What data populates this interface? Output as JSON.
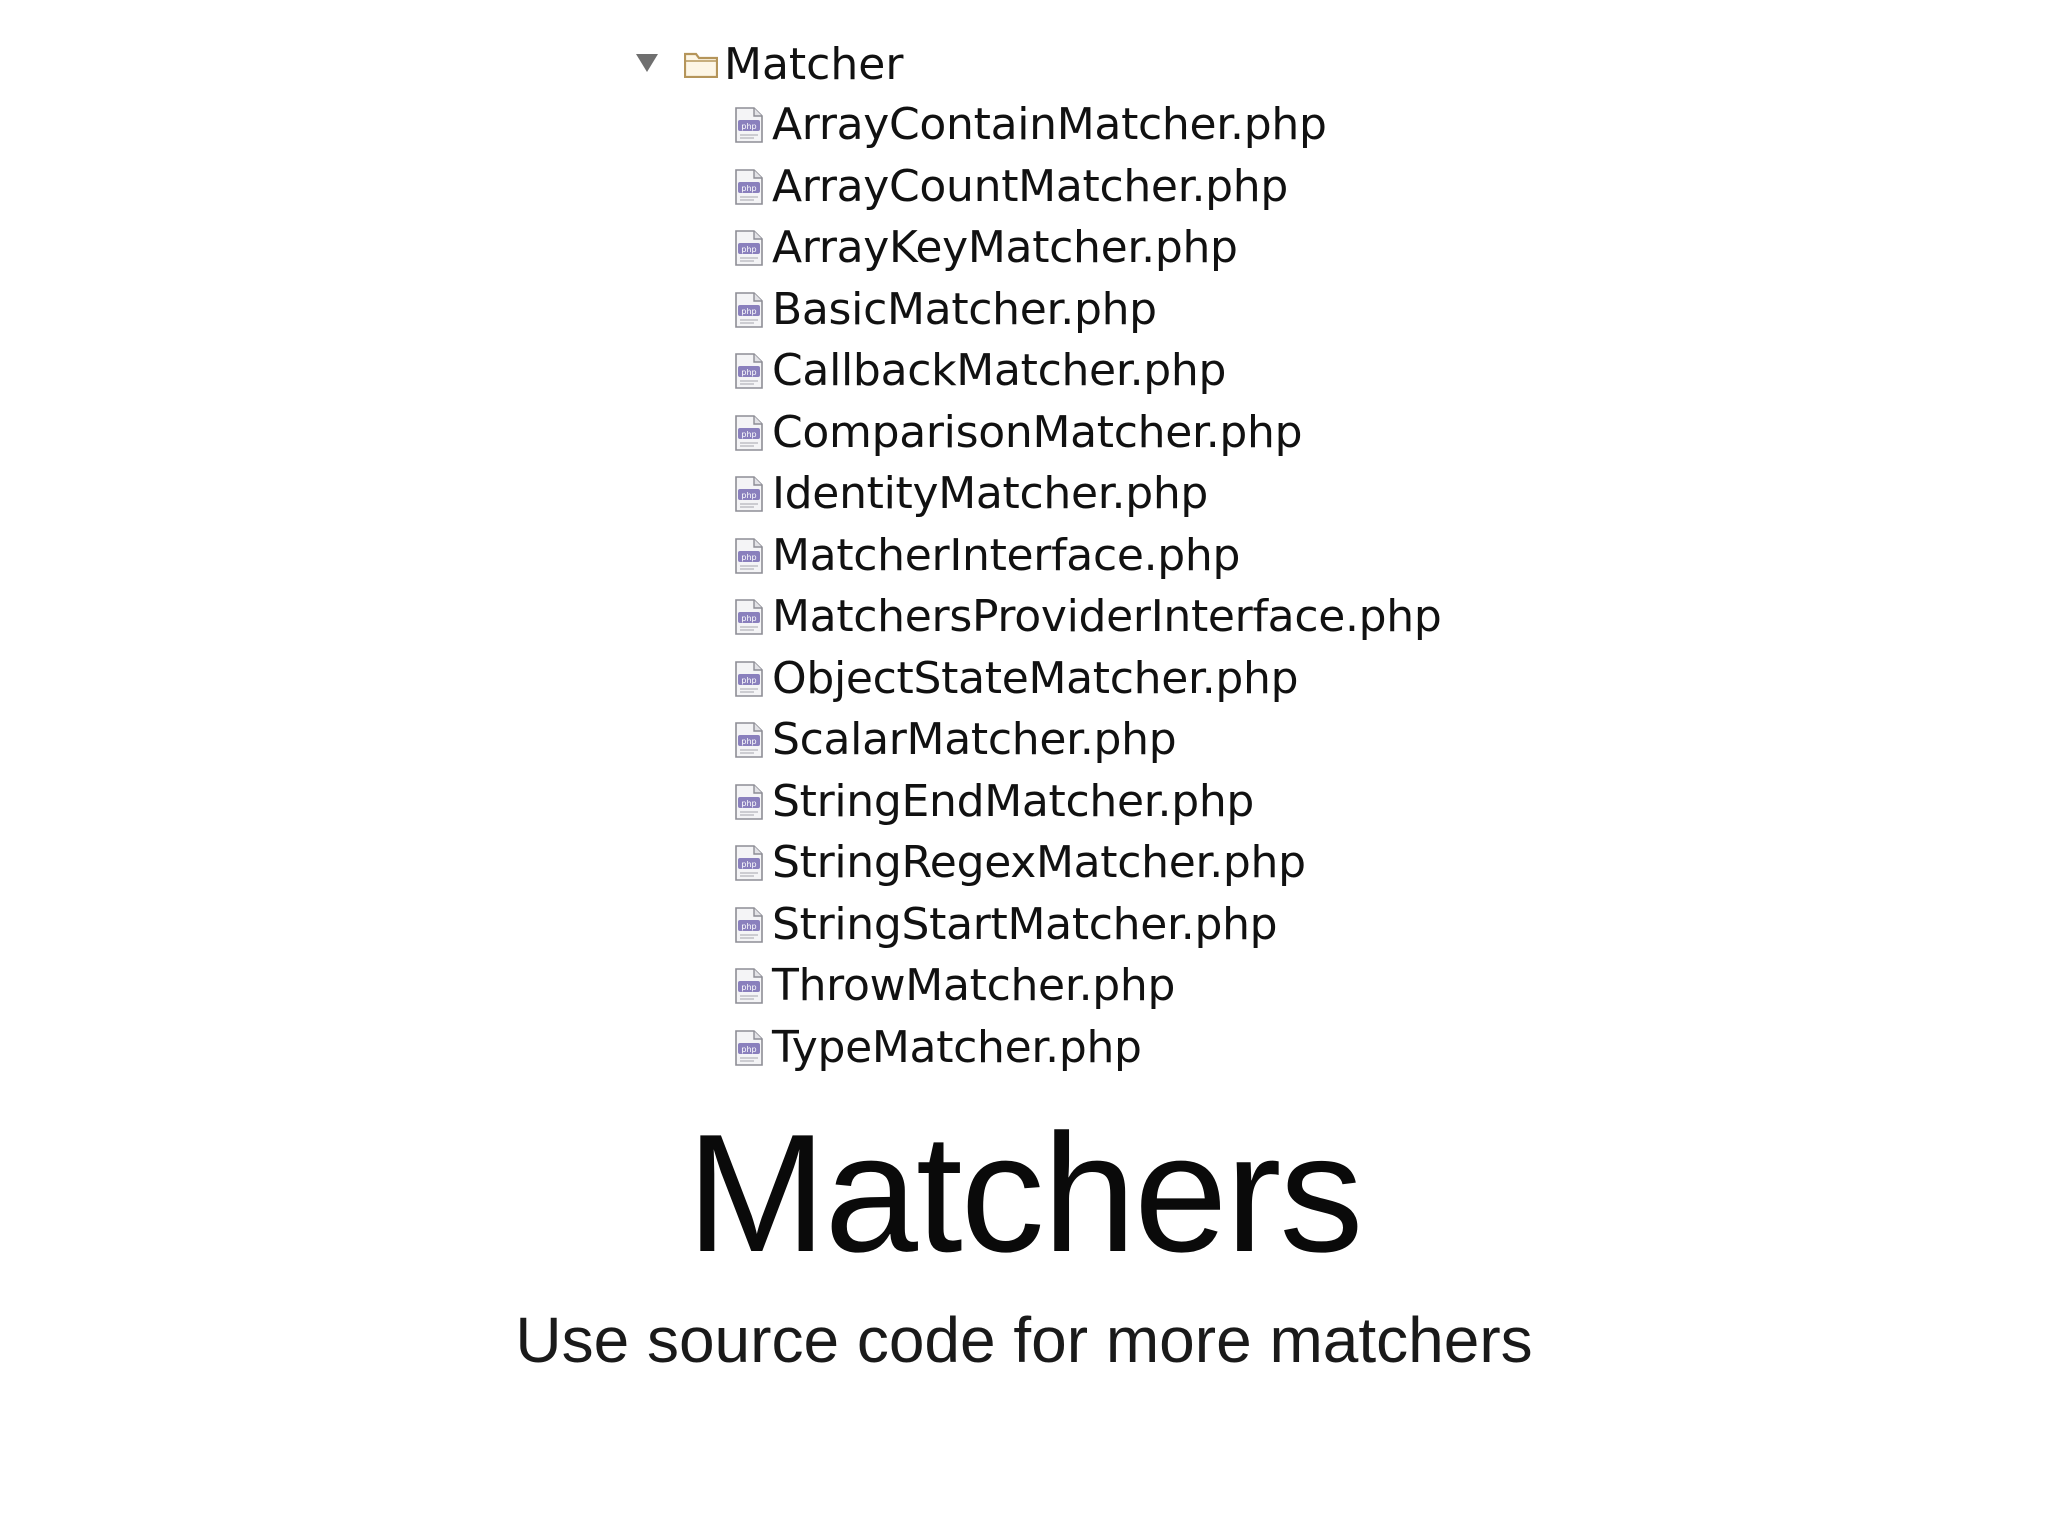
{
  "tree": {
    "folder": {
      "label": "Matcher",
      "expanded": true,
      "icon": "folder-icon",
      "disclosure_icon": "triangle-down-icon"
    },
    "file_icon": "php-file-icon",
    "files": [
      {
        "name": "ArrayContainMatcher.php"
      },
      {
        "name": "ArrayCountMatcher.php"
      },
      {
        "name": "ArrayKeyMatcher.php"
      },
      {
        "name": "BasicMatcher.php"
      },
      {
        "name": "CallbackMatcher.php"
      },
      {
        "name": "ComparisonMatcher.php"
      },
      {
        "name": "IdentityMatcher.php"
      },
      {
        "name": "MatcherInterface.php"
      },
      {
        "name": "MatchersProviderInterface.php"
      },
      {
        "name": "ObjectStateMatcher.php"
      },
      {
        "name": "ScalarMatcher.php"
      },
      {
        "name": "StringEndMatcher.php"
      },
      {
        "name": "StringRegexMatcher.php"
      },
      {
        "name": "StringStartMatcher.php"
      },
      {
        "name": "ThrowMatcher.php"
      },
      {
        "name": "TypeMatcher.php"
      }
    ]
  },
  "slide": {
    "title": "Matchers",
    "subtitle": "Use source code for more matchers"
  },
  "colors": {
    "folder": "#c9a86a",
    "php_badge": "#7b6fb0",
    "text": "#111111",
    "background": "#ffffff"
  }
}
